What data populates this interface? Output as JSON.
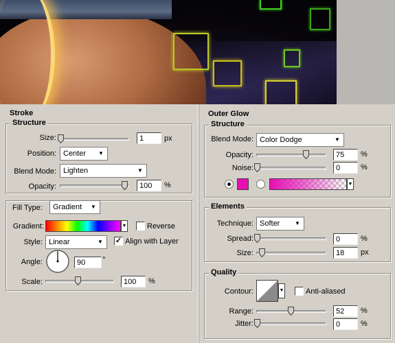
{
  "colors": {
    "panel_bg": "#d4d0c8",
    "glow_color": "#e60fb4",
    "stroke_gradient": "rainbow",
    "glow_gradient_start": "#e60fb4",
    "glow_gradient_end": "transparent"
  },
  "stroke": {
    "title": "Stroke",
    "structure": {
      "title": "Structure",
      "size_label": "Size:",
      "size_value": "1",
      "size_unit": "px",
      "size_slider_fraction": 0.0,
      "position_label": "Position:",
      "position_value": "Center",
      "blend_label": "Blend Mode:",
      "blend_value": "Lighten",
      "opacity_label": "Opacity:",
      "opacity_value": "100",
      "opacity_unit": "%",
      "opacity_slider_fraction": 1.0
    },
    "fill_type_label": "Fill Type:",
    "fill_type_value": "Gradient",
    "gradient_label": "Gradient:",
    "reverse_label": "Reverse",
    "reverse_checked": false,
    "style_label": "Style:",
    "style_value": "Linear",
    "align_label": "Align with Layer",
    "align_checked": true,
    "angle_label": "Angle:",
    "angle_value": "90",
    "angle_unit": "°",
    "scale_label": "Scale:",
    "scale_value": "100",
    "scale_unit": "%",
    "scale_slider_fraction": 0.5
  },
  "outer_glow": {
    "title": "Outer Glow",
    "structure": {
      "title": "Structure",
      "blend_label": "Blend Mode:",
      "blend_value": "Color Dodge",
      "opacity_label": "Opacity:",
      "opacity_value": "75",
      "opacity_unit": "%",
      "opacity_slider_fraction": 0.75,
      "noise_label": "Noise:",
      "noise_value": "0",
      "noise_unit": "%",
      "noise_slider_fraction": 0.0,
      "color_radio_selected": true,
      "gradient_radio_selected": false
    },
    "elements": {
      "title": "Elements",
      "technique_label": "Technique:",
      "technique_value": "Softer",
      "spread_label": "Spread:",
      "spread_value": "0",
      "spread_unit": "%",
      "spread_slider_fraction": 0.0,
      "size_label": "Size:",
      "size_value": "18",
      "size_unit": "px",
      "size_slider_fraction": 0.07
    },
    "quality": {
      "title": "Quality",
      "contour_label": "Contour:",
      "antialiased_label": "Anti-aliased",
      "antialiased_checked": false,
      "range_label": "Range:",
      "range_value": "52",
      "range_unit": "%",
      "range_slider_fraction": 0.52,
      "jitter_label": "Jitter:",
      "jitter_value": "0",
      "jitter_unit": "%",
      "jitter_slider_fraction": 0.0
    }
  }
}
